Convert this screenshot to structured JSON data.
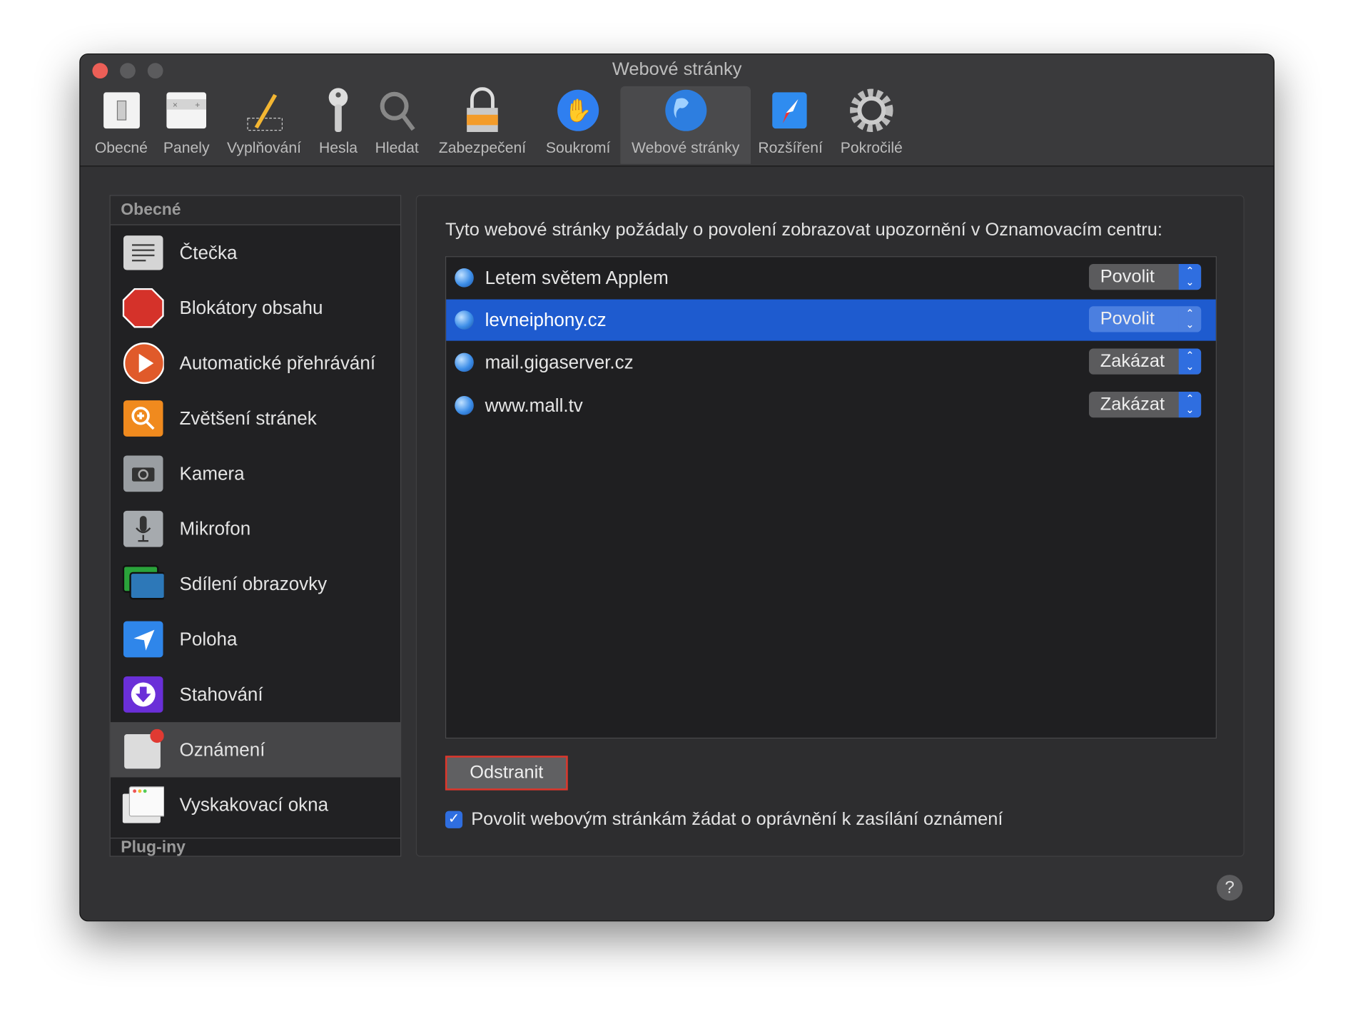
{
  "window": {
    "title": "Webové stránky"
  },
  "toolbar": [
    {
      "label": "Obecné",
      "icon": "switch-icon"
    },
    {
      "label": "Panely",
      "icon": "tabs-icon"
    },
    {
      "label": "Vyplňování",
      "icon": "pencil-icon"
    },
    {
      "label": "Hesla",
      "icon": "key-icon"
    },
    {
      "label": "Hledat",
      "icon": "magnifier-icon"
    },
    {
      "label": "Zabezpečení",
      "icon": "lock-icon"
    },
    {
      "label": "Soukromí",
      "icon": "hand-icon"
    },
    {
      "label": "Webové stránky",
      "icon": "globe-icon",
      "selected": true
    },
    {
      "label": "Rozšíření",
      "icon": "puzzle-icon"
    },
    {
      "label": "Pokročilé",
      "icon": "gear-icon"
    }
  ],
  "sidebar": {
    "section": "Obecné",
    "footer_section": "Plug-iny",
    "items": [
      {
        "label": "Čtečka"
      },
      {
        "label": "Blokátory obsahu"
      },
      {
        "label": "Automatické přehrávání"
      },
      {
        "label": "Zvětšení stránek"
      },
      {
        "label": "Kamera"
      },
      {
        "label": "Mikrofon"
      },
      {
        "label": "Sdílení obrazovky"
      },
      {
        "label": "Poloha"
      },
      {
        "label": "Stahování"
      },
      {
        "label": "Oznámení",
        "selected": true
      },
      {
        "label": "Vyskakovací okna"
      }
    ]
  },
  "main": {
    "heading": "Tyto webové stránky požádaly o povolení zobrazovat upozornění v Oznamovacím centru:",
    "sites": [
      {
        "name": "Letem světem Applem",
        "value": "Povolit"
      },
      {
        "name": "levneiphony.cz",
        "value": "Povolit",
        "selected": true
      },
      {
        "name": "mail.gigaserver.cz",
        "value": "Zakázat"
      },
      {
        "name": "www.mall.tv",
        "value": "Zakázat"
      }
    ],
    "remove_label": "Odstranit",
    "checkbox_label": "Povolit webovým stránkám žádat o oprávnění k zasílání oznámení",
    "checkbox_checked": true,
    "help_label": "?"
  },
  "colors": {
    "selection": "#1e5bcf",
    "accent": "#2f6ee0",
    "highlight_border": "#e0352a"
  }
}
